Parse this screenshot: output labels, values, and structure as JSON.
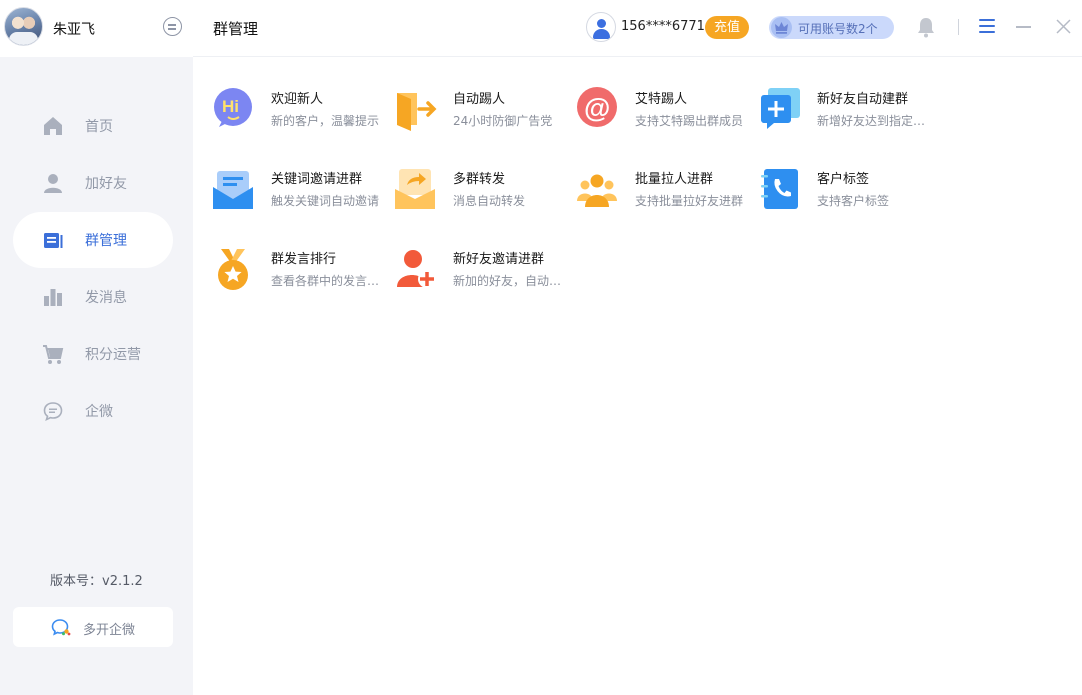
{
  "profile": {
    "name": "朱亚飞"
  },
  "sidebar": {
    "items": [
      {
        "label": "首页",
        "icon": "home-icon"
      },
      {
        "label": "加好友",
        "icon": "user-icon"
      },
      {
        "label": "群管理",
        "icon": "group-manage-icon",
        "active": true
      },
      {
        "label": "发消息",
        "icon": "bar-chart-icon"
      },
      {
        "label": "积分运营",
        "icon": "cart-icon"
      },
      {
        "label": "企微",
        "icon": "chat-bubble-icon"
      }
    ],
    "version": "版本号：v2.1.2",
    "multi_open_label": "多开企微"
  },
  "header": {
    "title": "群管理",
    "phone": "156****6771",
    "recharge_label": "充值",
    "accounts_label": "可用账号数2个"
  },
  "features": [
    {
      "title": "欢迎新人",
      "desc": "新的客户，温馨提示",
      "icon": "hi-welcome-icon"
    },
    {
      "title": "自动踢人",
      "desc": "24小时防御广告党",
      "icon": "exit-door-icon"
    },
    {
      "title": "艾特踢人",
      "desc": "支持艾特踢出群成员",
      "icon": "at-sign-icon"
    },
    {
      "title": "新好友自动建群",
      "desc": "新增好友达到指定数量",
      "icon": "add-group-icon"
    },
    {
      "title": "关键词邀请进群",
      "desc": "触发关键词自动邀请",
      "icon": "envelope-icon"
    },
    {
      "title": "多群转发",
      "desc": "消息自动转发",
      "icon": "forward-icon"
    },
    {
      "title": "批量拉人进群",
      "desc": "支持批量拉好友进群",
      "icon": "people-group-icon"
    },
    {
      "title": "客户标签",
      "desc": "支持客户标签",
      "icon": "phone-book-icon"
    },
    {
      "title": "群发言排行",
      "desc": "查看各群中的发言排行",
      "icon": "medal-icon"
    },
    {
      "title": "新好友邀请进群",
      "desc": "新加的好友，自动邀请",
      "icon": "user-add-icon"
    }
  ],
  "colors": {
    "accent": "#3b6fd9",
    "recharge": "#f6a623",
    "sidebar_bg": "#f3f4f8"
  }
}
